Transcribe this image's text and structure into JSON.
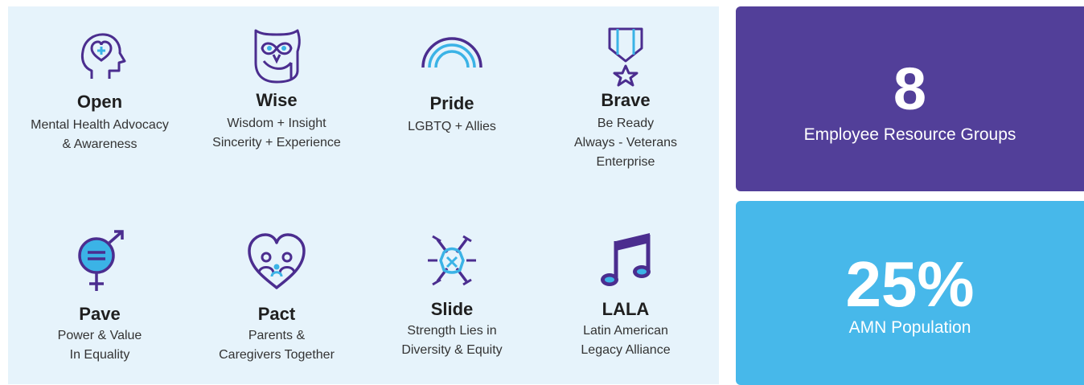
{
  "groups": [
    {
      "title": "Open",
      "desc": "Mental Health Advocacy\n& Awareness",
      "icon": "head-heart-icon"
    },
    {
      "title": "Wise",
      "desc": "Wisdom + Insight\nSincerity + Experience",
      "icon": "owl-icon"
    },
    {
      "title": "Pride",
      "desc": "LGBTQ + Allies",
      "icon": "rainbow-icon"
    },
    {
      "title": "Brave",
      "desc": "Be Ready\nAlways - Veterans\nEnterprise",
      "icon": "medal-icon"
    },
    {
      "title": "Pave",
      "desc": "Power & Value\nIn Equality",
      "icon": "gender-equality-icon"
    },
    {
      "title": "Pact",
      "desc": "Parents &\nCaregivers Together",
      "icon": "family-heart-icon"
    },
    {
      "title": "Slide",
      "desc": "Strength Lies in\nDiversity & Equity",
      "icon": "joined-hands-icon"
    },
    {
      "title": "LALA",
      "desc": "Latin American\nLegacy Alliance",
      "icon": "music-note-icon"
    }
  ],
  "stats": [
    {
      "value": "8",
      "label": "Employee Resource Groups",
      "color": "#523f99"
    },
    {
      "value": "25%",
      "label": "AMN Population",
      "color": "#47b8ea"
    }
  ],
  "colors": {
    "panel": "#e6f3fb",
    "icon_purple": "#4b2d8f",
    "icon_blue": "#3bb3e6"
  }
}
